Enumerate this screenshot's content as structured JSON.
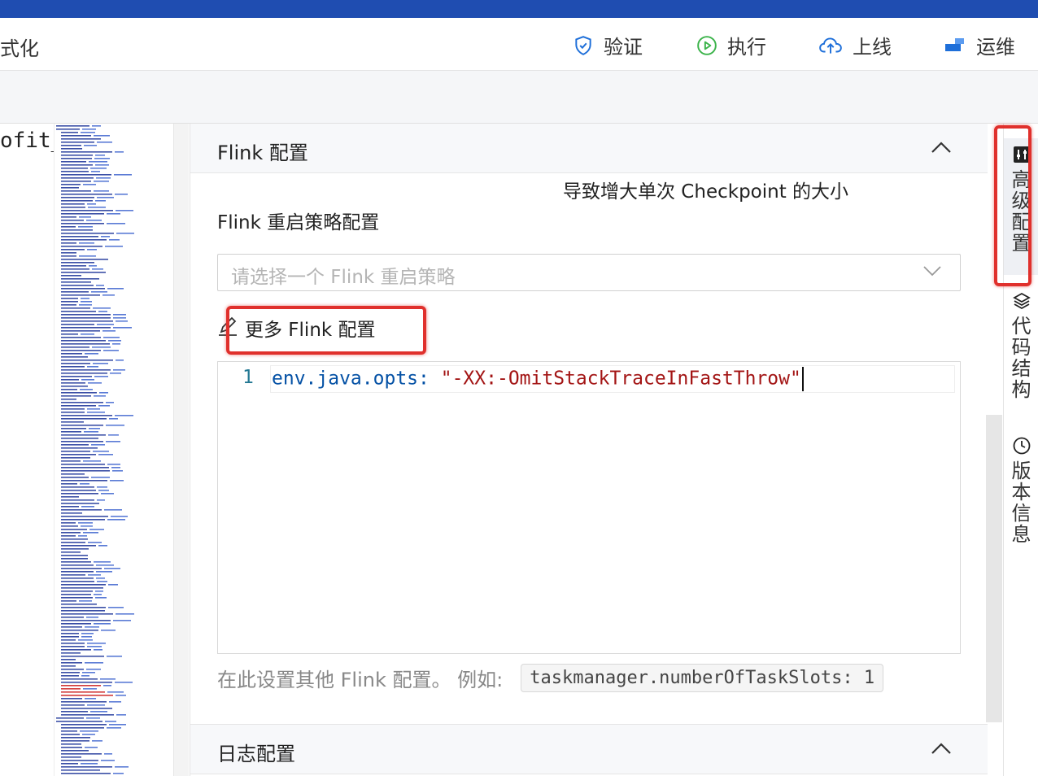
{
  "toolbar": {
    "partial_label": "式化",
    "buttons": [
      {
        "label": "验证",
        "icon": "shield-check-icon"
      },
      {
        "label": "执行",
        "icon": "play-circle-icon"
      },
      {
        "label": "上线",
        "icon": "cloud-upload-icon"
      },
      {
        "label": "运维",
        "icon": "ops-blocks-icon"
      }
    ]
  },
  "editor": {
    "partial_code": "ofit_"
  },
  "panel": {
    "flink_section": {
      "title": "Flink 配置",
      "tooltip_text": "导致增大单次 Checkpoint 的大小",
      "restart_label": "Flink 重启策略配置",
      "restart_placeholder": "请选择一个 Flink 重启策略",
      "more_label": "更多 Flink 配置",
      "code_line_number": "1",
      "code_key": "env.java.opts:",
      "code_value": "\"-XX:-OmitStackTraceInFastThrow\"",
      "hint_text": "在此设置其他 Flink 配置。 例如:",
      "hint_example": "taskmanager.numberOfTaskSlots: 1"
    },
    "log_section": {
      "title": "日志配置"
    }
  },
  "right_rail": [
    {
      "label": "高级配置",
      "icon": "sliders-icon",
      "active": true
    },
    {
      "label": "代码结构",
      "icon": "layers-icon",
      "active": false
    },
    {
      "label": "版本信息",
      "icon": "clock-icon",
      "active": false
    }
  ],
  "colors": {
    "top_bar": "#1f4db1",
    "accent_blue": "#1e6fd9",
    "run_green": "#3bb34a",
    "highlight_red": "#e0302c"
  }
}
